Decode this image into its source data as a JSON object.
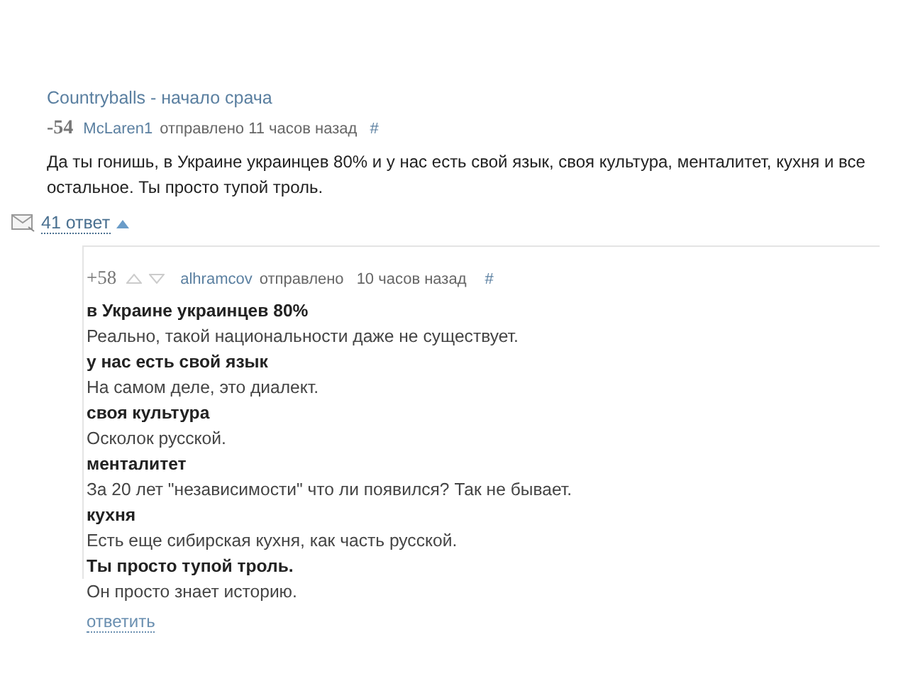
{
  "post_title": "Countryballs - начало срача",
  "comment": {
    "score": "-54",
    "author": "McLaren1",
    "meta": "отправлено 11 часов назад",
    "hash": "#",
    "text": "Да ты гонишь, в Украине украинцев 80% и у нас есть свой язык, своя культура, менталитет, кухня и все остальное. Ты просто тупой троль."
  },
  "replies_link": {
    "label": "41 ответ",
    "expanded": true
  },
  "reply": {
    "score": "+58",
    "author": "alhramcov",
    "meta": "отправлено",
    "time": "10 часов назад",
    "hash": "#",
    "lines": [
      {
        "kind": "quote",
        "text": "в Украине украинцев 80%"
      },
      {
        "kind": "answer",
        "text": "Реально, такой национальности даже не существует."
      },
      {
        "kind": "quote",
        "text": "у нас есть свой язык"
      },
      {
        "kind": "answer",
        "text": "На самом деле, это диалект."
      },
      {
        "kind": "quote",
        "text": "своя культура"
      },
      {
        "kind": "answer",
        "text": "Осколок русской."
      },
      {
        "kind": "quote",
        "text": "менталитет"
      },
      {
        "kind": "answer",
        "text": "За 20 лет \"независимости\" что ли появился? Так не бывает."
      },
      {
        "kind": "quote",
        "text": "кухня"
      },
      {
        "kind": "answer",
        "text": "Есть еще сибирская кухня, как часть русской."
      },
      {
        "kind": "quote",
        "text": "Ты просто тупой троль."
      },
      {
        "kind": "answer",
        "text": "Он просто знает историю."
      }
    ],
    "action": "ответить"
  }
}
